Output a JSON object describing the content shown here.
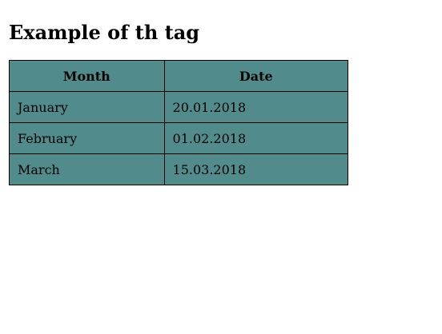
{
  "page": {
    "title": "Example of th tag"
  },
  "table": {
    "background": "#528b8b",
    "headers": [
      "Month",
      "Date"
    ],
    "rows": [
      [
        "January",
        "20.01.2018"
      ],
      [
        "February",
        "01.02.2018"
      ],
      [
        "March",
        "15.03.2018"
      ]
    ]
  }
}
